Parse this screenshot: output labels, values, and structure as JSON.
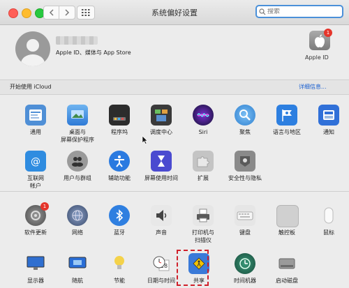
{
  "window": {
    "title": "系统偏好设置"
  },
  "search": {
    "placeholder": "搜索"
  },
  "account": {
    "subtitle": "Apple ID、媒体与 App Store"
  },
  "appleid": {
    "label": "Apple ID",
    "badge": "1"
  },
  "icloud": {
    "text": "开始使用 iCloud",
    "link": "详细信息..."
  },
  "row1": [
    {
      "label": "通用",
      "icon": "general-icon",
      "color": "#4f8fd6"
    },
    {
      "label": "桌面与\n屏幕保护程序",
      "icon": "desktop-screensaver-icon",
      "color": "#3a8ee0"
    },
    {
      "label": "程序坞",
      "icon": "dock-icon",
      "color": "#2c2c2c"
    },
    {
      "label": "调度中心",
      "icon": "mission-control-icon",
      "color": "#3a3a3a"
    },
    {
      "label": "Siri",
      "icon": "siri-icon",
      "color": "#1c1c3a"
    },
    {
      "label": "聚焦",
      "icon": "spotlight-icon",
      "color": "#3b8fd6"
    },
    {
      "label": "语言与地区",
      "icon": "language-region-icon",
      "color": "#2d7fe0"
    },
    {
      "label": "通知",
      "icon": "notifications-icon",
      "color": "#3070d8"
    }
  ],
  "row2": [
    {
      "label": "互联网\n帐户",
      "icon": "internet-accounts-icon",
      "color": "#2f8ce0"
    },
    {
      "label": "用户与群组",
      "icon": "users-groups-icon",
      "color": "#8a8a8a"
    },
    {
      "label": "辅助功能",
      "icon": "accessibility-icon",
      "color": "#2a7ae0"
    },
    {
      "label": "屏幕使用时间",
      "icon": "screen-time-icon",
      "color": "#4a4ad0"
    },
    {
      "label": "扩展",
      "icon": "extensions-icon",
      "color": "#b8b8b8"
    },
    {
      "label": "安全性与隐私",
      "icon": "security-privacy-icon",
      "color": "#7a7a7a"
    }
  ],
  "row3": [
    {
      "label": "软件更新",
      "icon": "software-update-icon",
      "color": "#6a6a6a",
      "badge": "1"
    },
    {
      "label": "网络",
      "icon": "network-icon",
      "color": "#5a6a8a"
    },
    {
      "label": "蓝牙",
      "icon": "bluetooth-icon",
      "color": "#2f7fe0"
    },
    {
      "label": "声音",
      "icon": "sound-icon",
      "color": "#555555"
    },
    {
      "label": "打印机与\n扫描仪",
      "icon": "printers-scanners-icon",
      "color": "#6a6a6a"
    },
    {
      "label": "键盘",
      "icon": "keyboard-icon",
      "color": "#d8d8d8"
    },
    {
      "label": "触控板",
      "icon": "trackpad-icon",
      "color": "#c9c9c9"
    },
    {
      "label": "鼠标",
      "icon": "mouse-icon",
      "color": "#f0f0f0"
    }
  ],
  "row4": [
    {
      "label": "显示器",
      "icon": "displays-icon",
      "color": "#2f6fd0"
    },
    {
      "label": "随航",
      "icon": "sidecar-icon",
      "color": "#2a6ed6"
    },
    {
      "label": "节能",
      "icon": "energy-saver-icon",
      "color": "#f4d24a"
    },
    {
      "label": "日期与时间",
      "icon": "date-time-icon",
      "color": "#e0e0e0"
    },
    {
      "label": "共享",
      "icon": "sharing-icon",
      "color": "#3a7ad8"
    },
    {
      "label": "时间机器",
      "icon": "time-machine-icon",
      "color": "#2a6a5a"
    },
    {
      "label": "启动磁盘",
      "icon": "startup-disk-icon",
      "color": "#8a8a8a"
    }
  ]
}
